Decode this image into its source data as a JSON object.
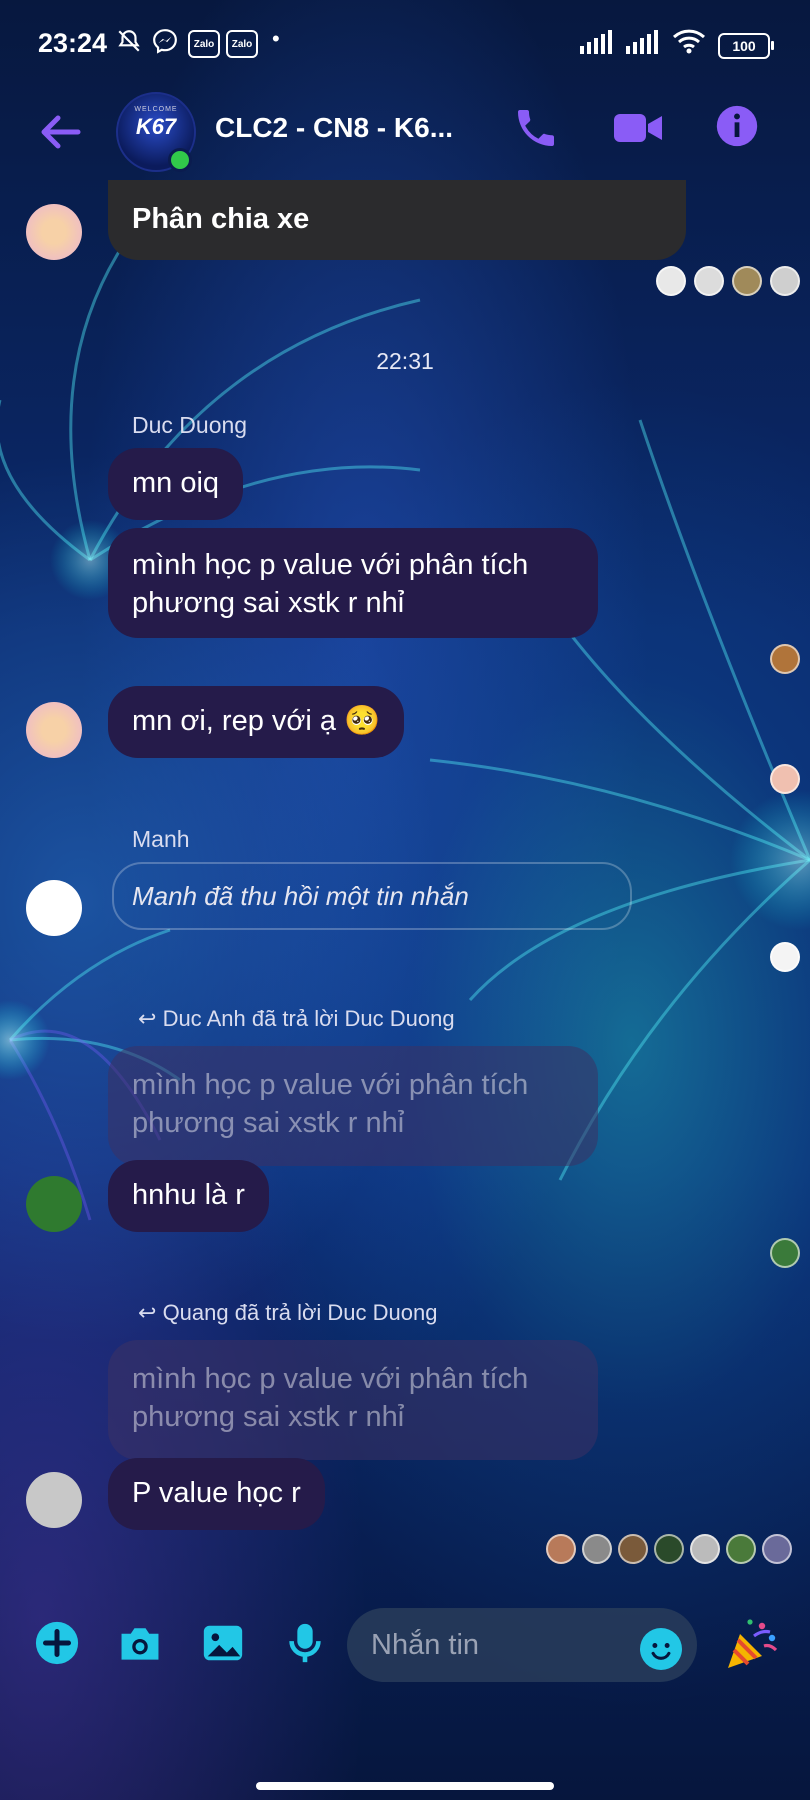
{
  "status_bar": {
    "time": "23:24",
    "zalo_1": "Zalo",
    "zalo_2": "Zalo",
    "dot": "•",
    "battery": "100"
  },
  "header": {
    "title": "CLC2 - CN8 - K6...",
    "avatar_welcome": "WELCOME",
    "avatar_code": "K67",
    "accent_color": "#8a5cf6"
  },
  "messages": {
    "prev_message": "Phân chia xe",
    "timestamp": "22:31",
    "sender_1": "Duc Duong",
    "msg_1": "mn oiq",
    "msg_2_line1": "mình học p value với phân tích",
    "msg_2_line2": "phương sai xstk r nhỉ",
    "msg_3": "mn ơi, rep với ạ 🥺",
    "sender_2": "Manh",
    "recall_text": "Manh đã thu hồi một tin nhắn",
    "reply_header_1": "Duc Anh đã trả lời Duc Duong",
    "quoted_1_line1": "mình học p value với phân tích",
    "quoted_1_line2": "phương sai xstk r nhỉ",
    "msg_4": "hnhu là r",
    "reply_header_2": "Quang đã trả lời Duc Duong",
    "quoted_2_line1": "mình học p value với phân tích",
    "quoted_2_line2": "phương sai xstk r nhỉ",
    "msg_5": "P value học r"
  },
  "composer": {
    "placeholder": "Nhắn tin",
    "icon_color": "#22c7e6"
  }
}
